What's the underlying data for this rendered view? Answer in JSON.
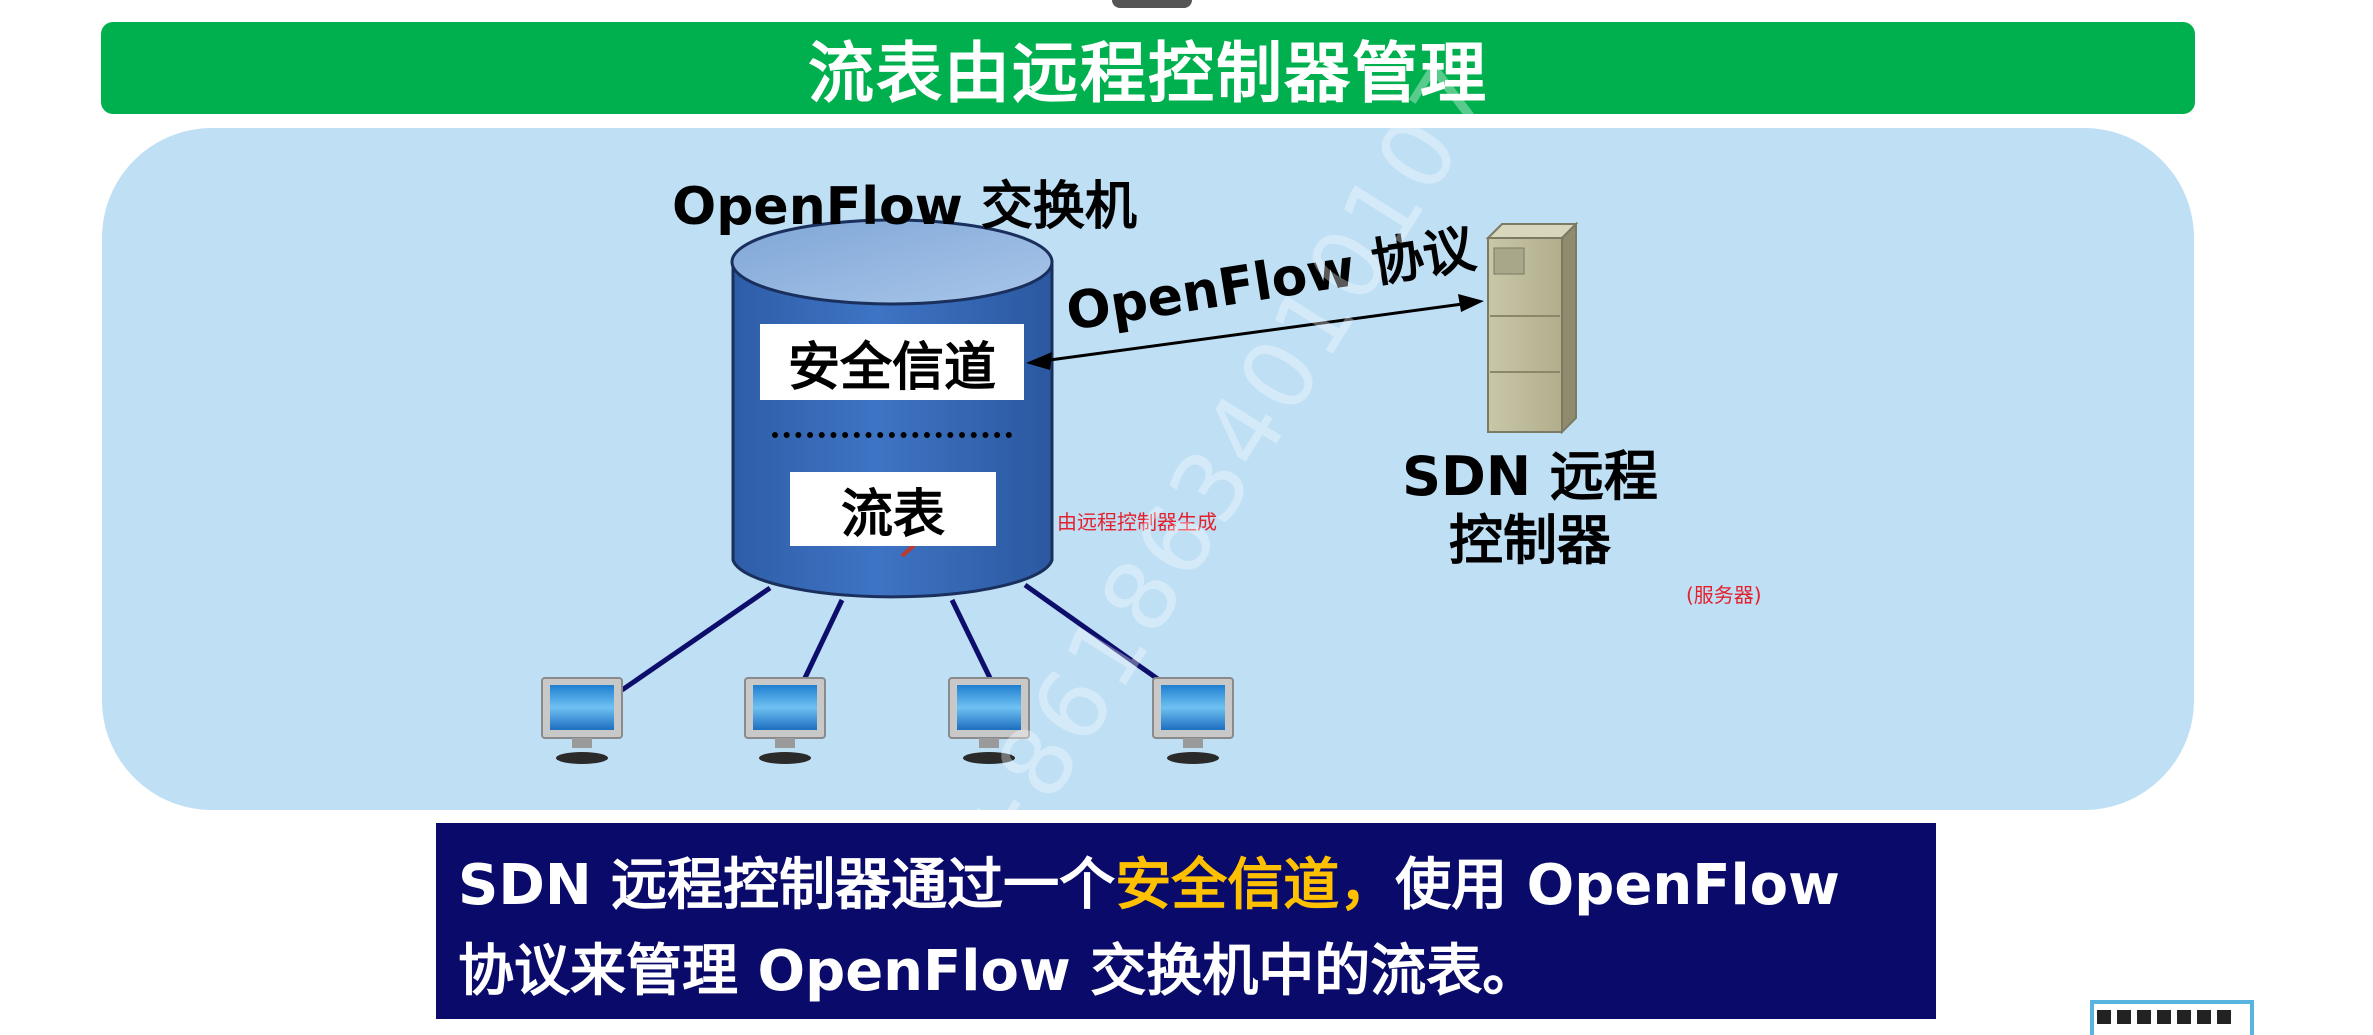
{
  "title": "流表由远程控制器管理",
  "diagram": {
    "switch_title": "OpenFlow 交换机",
    "secure_channel": "安全信道",
    "flow_table": "流表",
    "protocol_label": "OpenFlow 协议",
    "controller_line1": "SDN 远程",
    "controller_line2": "控制器",
    "annotation_generated": "由远程控制器生成",
    "annotation_server": "(服务器)"
  },
  "caption": {
    "part1": "SDN 远程控制器通过一个",
    "highlight": "安全信道，",
    "part2": "使用 OpenFlow",
    "line2": "协议来管理 OpenFlow 交换机中的流表。"
  },
  "watermark": "+8618634010107",
  "colors": {
    "title_bg": "#00b04f",
    "panel_bg": "#bfdff4",
    "caption_bg": "#0a0a6a",
    "highlight": "#ffc000",
    "annotation": "#e5202d"
  }
}
